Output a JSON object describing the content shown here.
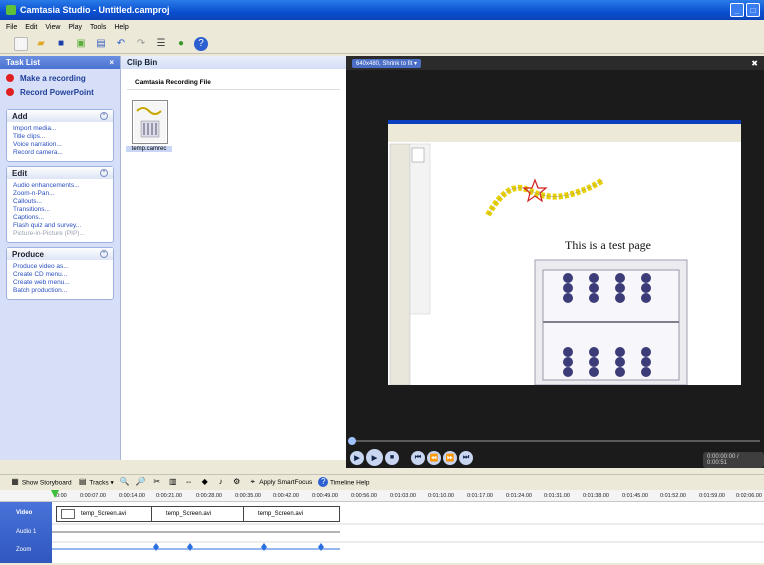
{
  "window": {
    "title": "Camtasia Studio - Untitled.camproj"
  },
  "menu": [
    "File",
    "Edit",
    "View",
    "Play",
    "Tools",
    "Help"
  ],
  "tasklist": {
    "title": "Task List",
    "close": "×",
    "record": [
      "Make a recording",
      "Record PowerPoint"
    ],
    "sections": [
      {
        "title": "Add",
        "items": [
          "Import media...",
          "Title clips...",
          "Voice narration...",
          "Record camera..."
        ]
      },
      {
        "title": "Edit",
        "items": [
          "Audio enhancements...",
          "Zoom-n-Pan...",
          "Callouts...",
          "Transitions...",
          "Captions...",
          "Flash quiz and survey...",
          "Picture-in-Picture (PIP)..."
        ],
        "disabled_index": 6
      },
      {
        "title": "Produce",
        "items": [
          "Produce video as...",
          "Create CD menu...",
          "Create web menu...",
          "Batch production..."
        ]
      }
    ]
  },
  "clipbin": {
    "title": "Clip Bin",
    "section": "Camtasia Recording File",
    "thumb_label": "temp.camrec"
  },
  "preview": {
    "size_select": "640x480, Shrink to fit",
    "page_text": "This is a test page",
    "timecode": "0:00:00:00 / 0:00:51"
  },
  "timeline_toolbar": {
    "show_storyboard": "Show Storyboard",
    "tracks": "Tracks",
    "smartfocus": "Apply SmartFocus",
    "help": "Timeline Help"
  },
  "ruler": [
    "0:00",
    "0:00:07.00",
    "0:00:14.00",
    "0:00:21.00",
    "0:00:28.00",
    "0:00:35.00",
    "0:00:42.00",
    "0:00:49.00",
    "0:00:56.00",
    "0:01:03.00",
    "0:01:10.00",
    "0:01:17.00",
    "0:01:24.00",
    "0:01:31.00",
    "0:01:38.00",
    "0:01:45.00",
    "0:01:52.00",
    "0:01:59.00",
    "0:02:06.00"
  ],
  "tracks": {
    "labels": [
      "Video",
      "Audio 1",
      "Zoom"
    ],
    "clips": [
      "temp_Screen.avi",
      "temp_Screen.avi",
      "temp_Screen.avi"
    ]
  }
}
